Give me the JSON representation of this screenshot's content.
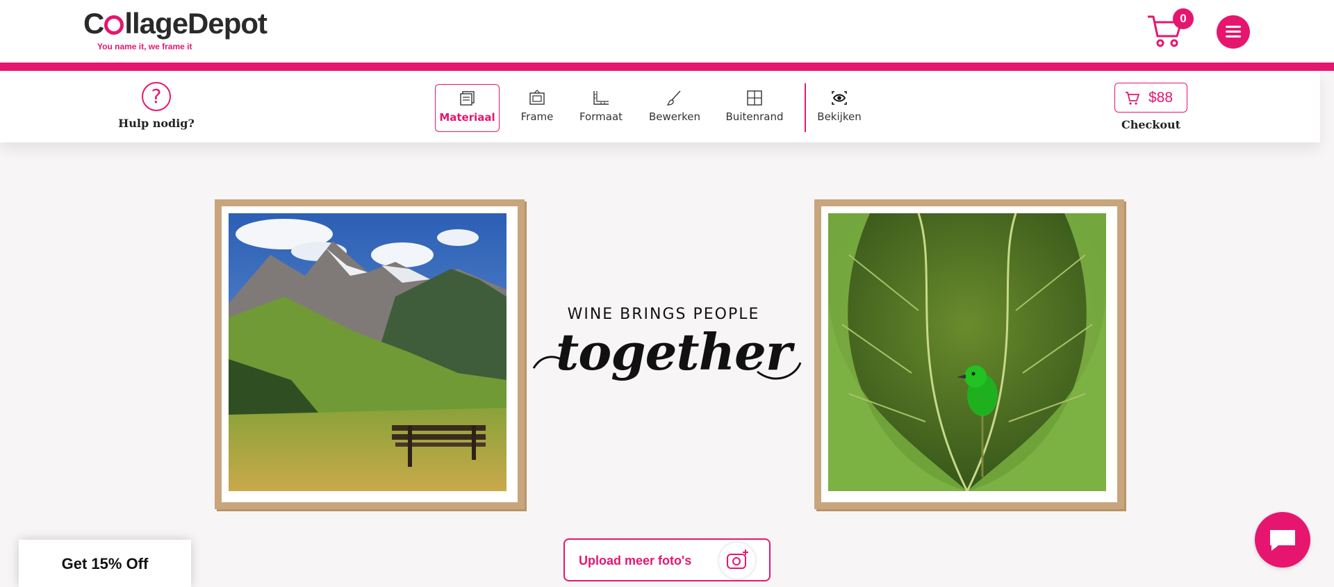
{
  "brand": {
    "name_prefix": "C",
    "name_suffix": "llageDepot",
    "tagline": "You name it, we frame it",
    "accent_color": "#e6166f"
  },
  "header": {
    "cart_count": "0",
    "cart_icon": "shopping-cart-icon",
    "menu_icon": "hamburger-menu-icon"
  },
  "toolbar": {
    "help_label": "Hulp nodig?",
    "help_icon": "question-mark-icon",
    "tools": [
      {
        "label": "Materiaal",
        "icon": "material-stack-icon",
        "active": true
      },
      {
        "label": "Frame",
        "icon": "frame-icon",
        "active": false
      },
      {
        "label": "Formaat",
        "icon": "ruler-corner-icon",
        "active": false
      },
      {
        "label": "Bewerken",
        "icon": "brush-icon",
        "active": false
      },
      {
        "label": "Buitenrand",
        "icon": "grid-border-icon",
        "active": false
      },
      {
        "label": "Bekijken",
        "icon": "eye-icon",
        "active": false
      }
    ],
    "checkout_price": "$88",
    "checkout_label": "Checkout"
  },
  "canvas": {
    "quote_line1": "WINE BRINGS PEOPLE",
    "quote_line2": "together",
    "frame_color": "#c8a57c",
    "photos": [
      "mountain-landscape-photo",
      "green-bird-leaves-photo"
    ]
  },
  "upload": {
    "label": "Upload meer foto's",
    "icon": "add-photo-camera-icon"
  },
  "discount": {
    "label": "Get 15% Off"
  },
  "chat": {
    "icon": "chat-bubble-icon"
  }
}
